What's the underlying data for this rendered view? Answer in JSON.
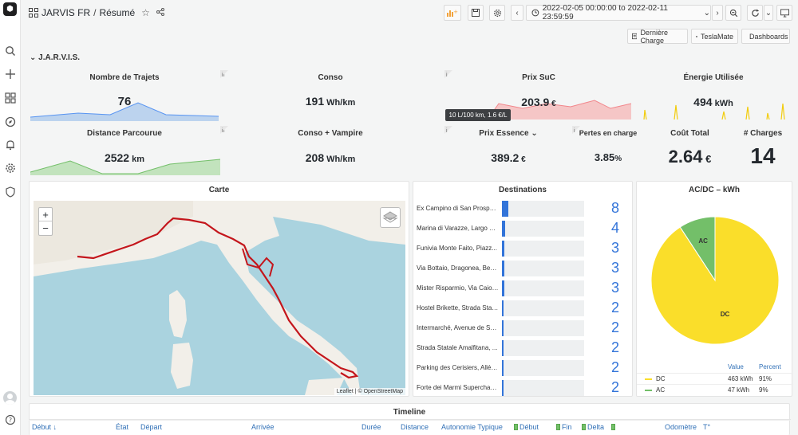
{
  "sidebar": {
    "logo_glyph": "⬢"
  },
  "header": {
    "app_title": "JARVIS FR",
    "separator": "/",
    "page_title": "Résumé",
    "time_range": "2022-02-05 00:00:00 to 2022-02-11 23:59:59"
  },
  "links": {
    "derniere_charge": "Dernière Charge",
    "teslamate": "TeslaMate",
    "dashboards": "Dashboards"
  },
  "row_title": "J.A.R.V.I.S.",
  "stats": {
    "trajets": {
      "title": "Nombre de Trajets",
      "value": "76",
      "unit": ""
    },
    "conso": {
      "title": "Conso",
      "value": "191",
      "unit": " Wh/km"
    },
    "prix_suc": {
      "title": "Prix SuC",
      "value": "203.9",
      "unit": " €"
    },
    "energie": {
      "title": "Énergie Utilisée",
      "value": "494",
      "unit": " kWh"
    },
    "distance": {
      "title": "Distance Parcourue",
      "value": "2522",
      "unit": " km"
    },
    "conso_vampire": {
      "title": "Conso + Vampire",
      "value": "208",
      "unit": " Wh/km"
    },
    "prix_essence": {
      "title": "Prix Essence",
      "value": "389.2",
      "unit": " €"
    },
    "pertes": {
      "title": "Pertes en charge",
      "value": "3.85",
      "unit": "%"
    },
    "cout": {
      "title": "Coût Total",
      "value": "2.64",
      "unit": " €"
    },
    "charges": {
      "title": "# Charges",
      "value": "14"
    }
  },
  "tooltip": "10 L/100 km, 1.6 €/L",
  "carte": {
    "title": "Carte",
    "attribution": "Leaflet | © OpenStreetMap",
    "zoom_in": "+",
    "zoom_out": "−"
  },
  "destinations": {
    "title": "Destinations",
    "items": [
      {
        "name": "Ex Campino di San Prosper...",
        "value": "8",
        "fraction": 0.08
      },
      {
        "name": "Marina di Varazze, Largo Fi...",
        "value": "4",
        "fraction": 0.04
      },
      {
        "name": "Funivia Monte Faito, Piazz...",
        "value": "3",
        "fraction": 0.03
      },
      {
        "name": "Via Bottaio, Dragonea, Ben...",
        "value": "3",
        "fraction": 0.03
      },
      {
        "name": "Mister Risparmio, Via Caio ...",
        "value": "3",
        "fraction": 0.03
      },
      {
        "name": "Hostel Brikette, Strada Stat...",
        "value": "2",
        "fraction": 0.02
      },
      {
        "name": "Intermarché, Avenue de Sa...",
        "value": "2",
        "fraction": 0.02
      },
      {
        "name": "Strada Statale Amalfitana, ...",
        "value": "2",
        "fraction": 0.02
      },
      {
        "name": "Parking des Cerisiers, Allée...",
        "value": "2",
        "fraction": 0.02
      },
      {
        "name": "Forte dei Marmi Supercharg...",
        "value": "2",
        "fraction": 0.02
      }
    ]
  },
  "acdc": {
    "title": "AC/DC – kWh",
    "headers": {
      "value": "Value",
      "percent": "Percent"
    },
    "rows": [
      {
        "label": "DC",
        "value": "463 kWh",
        "percent": "91%",
        "color": "#fade2a"
      },
      {
        "label": "AC",
        "value": "47 kWh",
        "percent": "9%",
        "color": "#73bf69"
      }
    ]
  },
  "timeline": {
    "title": "Timeline",
    "columns": [
      "Début ↓",
      "État",
      "Départ",
      "Arrivée",
      "Durée",
      "Distance",
      "Autonomie Typique",
      "Début",
      "Fin",
      "Delta",
      "",
      "Odomètre",
      "T°"
    ]
  },
  "chart_data": {
    "type": "pie",
    "categories": [
      "DC",
      "AC"
    ],
    "values": [
      463,
      47
    ],
    "title": "AC/DC – kWh"
  }
}
